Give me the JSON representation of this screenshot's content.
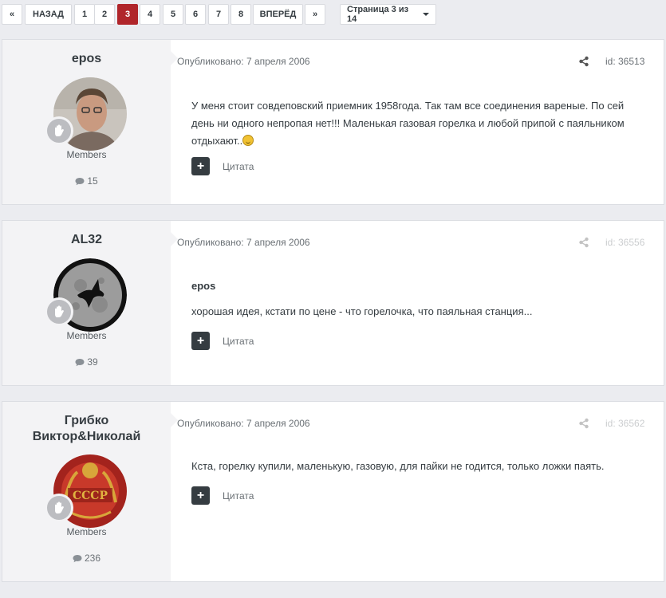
{
  "pagination": {
    "first": "«",
    "prev": "НАЗАД",
    "pages": [
      "1",
      "2",
      "3",
      "4",
      "5",
      "6",
      "7",
      "8"
    ],
    "active_page": "3",
    "next": "ВПЕРЁД",
    "last": "»",
    "jump": "Страница 3 из 14"
  },
  "posts": [
    {
      "author": "epos",
      "group": "Members",
      "post_count": "15",
      "published": "Опубликовано: 7 апреля 2006",
      "id": "id: 36513",
      "text": "У меня стоит совдеповский приемник 1958года. Так там все соединения вареные. По сей день ни одного непропая нет!!! Маленькая газовая горелка и любой припой с паяльником отдыхают..",
      "quote_label": "Цитата"
    },
    {
      "author": "AL32",
      "group": "Members",
      "post_count": "39",
      "published": "Опубликовано: 7 апреля 2006",
      "id": "id: 36556",
      "quoted_author": "epos",
      "text": "хорошая идея, кстати по цене - что горелочка, что паяльная станция...",
      "quote_label": "Цитата"
    },
    {
      "author_line1": "Грибко",
      "author_line2": "Виктор&Николай",
      "group": "Members",
      "post_count": "236",
      "published": "Опубликовано: 7 апреля 2006",
      "id": "id: 36562",
      "text": "Кста, горелку купили, маленькую, газовую, для пайки не годится, только ложки паять.",
      "quote_label": "Цитата",
      "avatar_text": "СССР"
    }
  ],
  "colors": {
    "accent": "#b0252a",
    "page_bg": "#ebecf0",
    "author_panel": "#f3f3f5",
    "dark_button": "#353c41"
  }
}
